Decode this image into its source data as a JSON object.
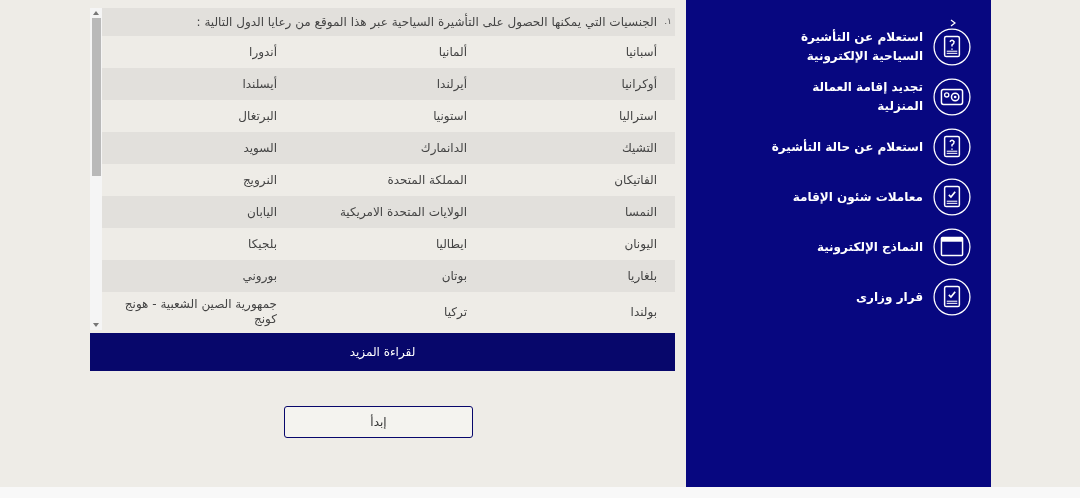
{
  "intro": {
    "marker": "١.",
    "text": "الجنسيات التي يمكنها الحصول على التأشيرة السياحية عبر هذا الموقع من رعايا الدول التالية :"
  },
  "countries": [
    [
      "أسبانيا",
      "ألمانيا",
      "أندورا"
    ],
    [
      "أوكرانيا",
      "أيرلندا",
      "أيسلندا"
    ],
    [
      "استراليا",
      "استونيا",
      "البرتغال"
    ],
    [
      "التشيك",
      "الدانمارك",
      "السويد"
    ],
    [
      "الفاتيكان",
      "المملكة المتحدة",
      "النرويج"
    ],
    [
      "النمسا",
      "الولايات المتحدة الامريكية",
      "اليابان"
    ],
    [
      "اليونان",
      "ايطاليا",
      "بلجيكا"
    ],
    [
      "بلغاريا",
      "بوتان",
      "بوروني"
    ],
    [
      "بولندا",
      "تركيا",
      "جمهورية الصين الشعبية - هونج كونج"
    ]
  ],
  "read_more": "لقراءة المزيد",
  "start": "إبدأ",
  "menu": [
    {
      "label": "استعلام عن التأشيرة السياحية الإلكترونية",
      "kind": "question",
      "expanded": false
    },
    {
      "label": "تجديد إقامة العمالة المنزلية",
      "kind": "card"
    },
    {
      "label": "استعلام عن حالة التأشيرة",
      "kind": "question"
    },
    {
      "label": "معاملات شئون الإقامة",
      "kind": "check"
    },
    {
      "label": "النماذج الإلكترونية",
      "kind": "form"
    },
    {
      "label": "قرار وزارى",
      "kind": "check"
    }
  ]
}
